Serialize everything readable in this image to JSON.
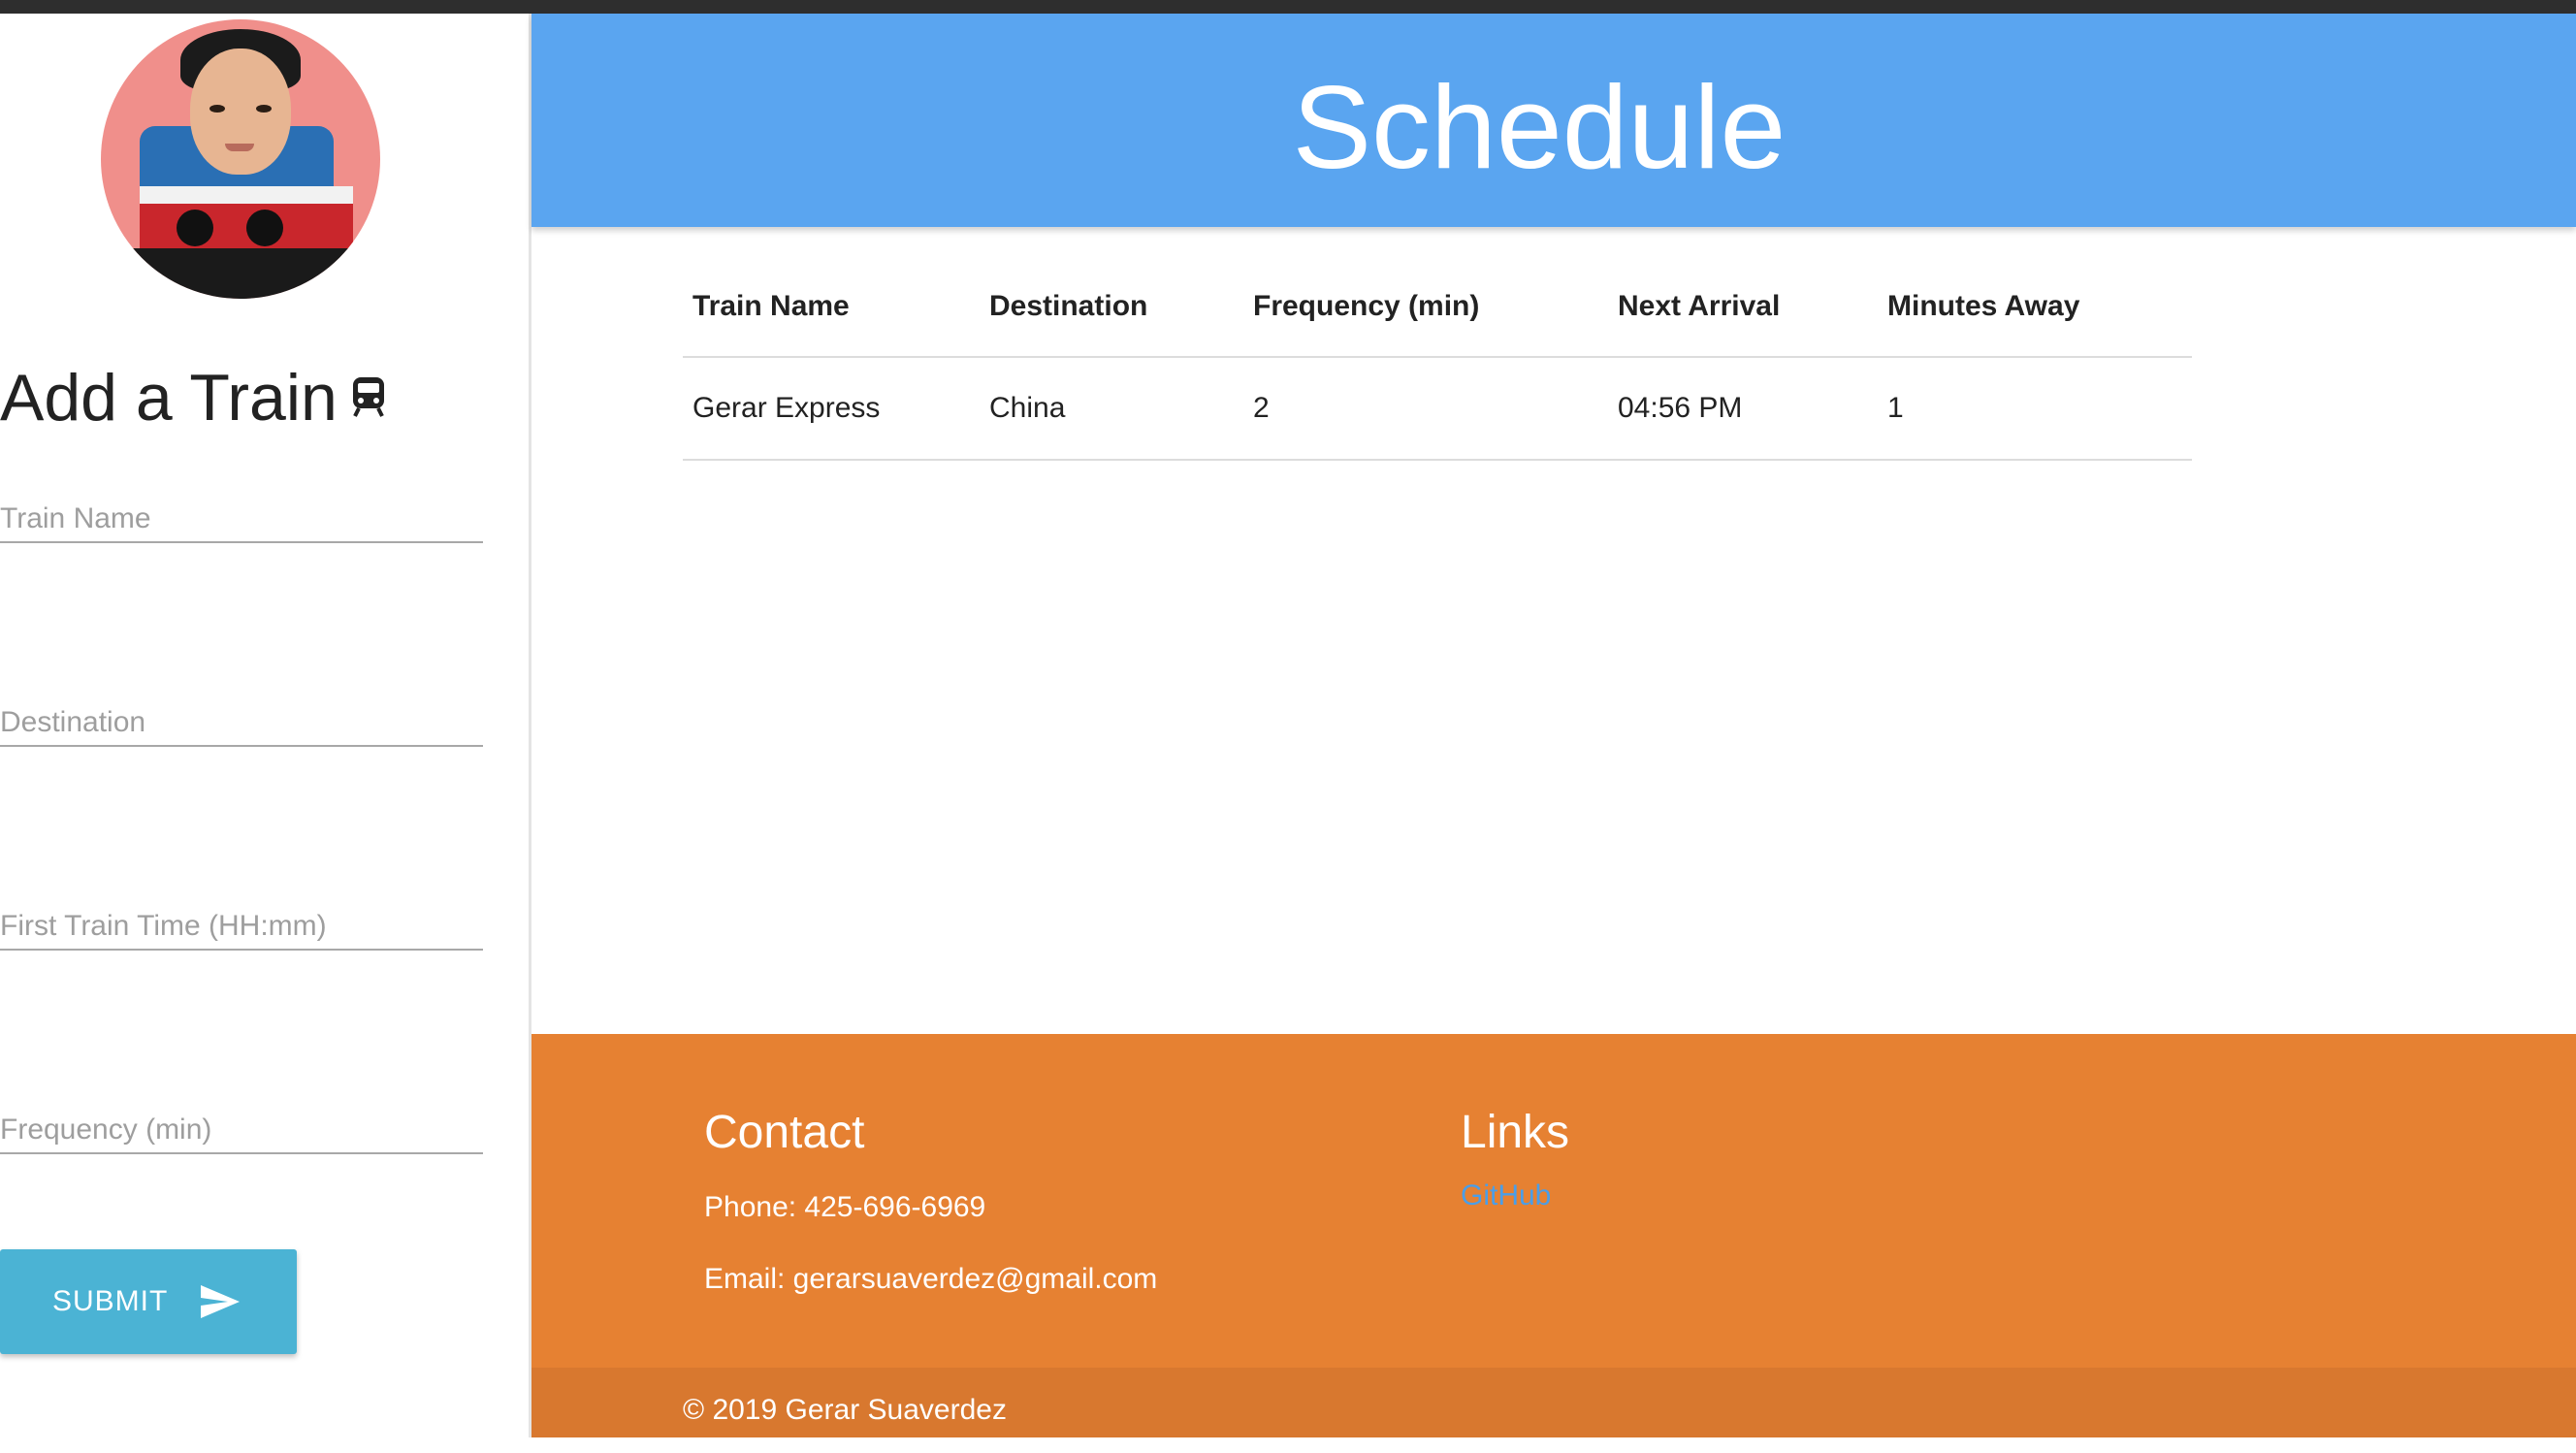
{
  "sidebar": {
    "heading": "Add a Train",
    "heading_icon": "train-icon",
    "fields": [
      {
        "placeholder": "Train Name",
        "value": ""
      },
      {
        "placeholder": "Destination",
        "value": ""
      },
      {
        "placeholder": "First Train Time (HH:mm)",
        "value": ""
      },
      {
        "placeholder": "Frequency (min)",
        "value": ""
      }
    ],
    "submit_label": "SUBMIT",
    "submit_icon": "send-icon"
  },
  "header": {
    "title": "Schedule"
  },
  "table": {
    "columns": [
      "Train Name",
      "Destination",
      "Frequency (min)",
      "Next Arrival",
      "Minutes Away"
    ],
    "rows": [
      [
        "Gerar Express",
        "China",
        "2",
        "04:56 PM",
        "1"
      ]
    ]
  },
  "footer": {
    "contact_title": "Contact",
    "phone": "Phone: 425-696-6969",
    "email": "Email: gerarsuaverdez@gmail.com",
    "links_title": "Links",
    "github_label": "GitHub",
    "copyright": "© 2019 Gerar Suaverdez"
  },
  "colors": {
    "header_bg": "#5aa5f0",
    "footer_bg": "#e68132",
    "copyright_bg": "#d8782f",
    "submit_bg": "#4bb3d4",
    "link": "#4a9ee8"
  }
}
